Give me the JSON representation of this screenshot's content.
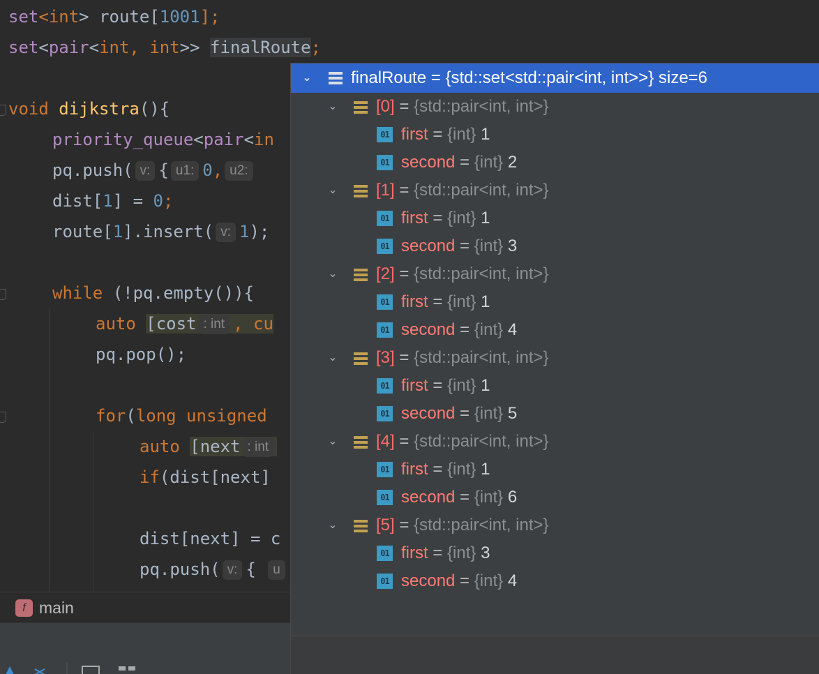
{
  "editor": {
    "line1": {
      "kw": "set",
      "targ1": "<",
      "targ_kw": "int",
      "targ2": "> route[",
      "num": "1001",
      "end": "];"
    },
    "line2": {
      "kw": "set",
      "a": "<",
      "b": "pair",
      "c": "<",
      "d": "int",
      "e": ", ",
      "f": "int",
      "g": ">> ",
      "name": "finalRoute",
      "end": ";"
    },
    "line3": {
      "kw": "void",
      "fn": "dijkstra",
      "rest": "(){"
    },
    "line4": {
      "type": "priority_queue",
      "lt": "<",
      "pair": "pair",
      "lt2": "<",
      "rest": "in"
    },
    "line5": {
      "obj": "pq.push(",
      "hint_v": "v:",
      "brace": "{",
      "hint_u1": "u1:",
      "num0": "0",
      "comma": ",",
      "hint_u2": "u2:"
    },
    "line6": {
      "text": "dist[",
      "num1": "1",
      "text2": "] = ",
      "num0": "0",
      "end": ";"
    },
    "line7": {
      "text": "route[",
      "num1": "1",
      "text2": "].insert(",
      "hint_v": "v:",
      "num": "1",
      "end": ");"
    },
    "line8": {
      "kw": "while",
      "rest": " (!pq.empty()){"
    },
    "line9": {
      "kw": "auto",
      "open": "[cost",
      "hint": ": int",
      "rest": ", cu"
    },
    "line10": {
      "text": "pq.pop();"
    },
    "line11": {
      "kw": "for",
      "open": "(",
      "kw2": "long unsigned"
    },
    "line12": {
      "kw": "auto",
      "open": "[next",
      "hint": ": int"
    },
    "line13": {
      "kw": "if",
      "rest": "(dist[next]"
    },
    "line14": {
      "text": "dist[next] = c"
    },
    "line15": {
      "text": "pq.push(",
      "hint_v": "v:",
      "brace": "{",
      "rest": "u"
    }
  },
  "breadcrumb": {
    "badge": "f",
    "label": "main"
  },
  "debug_popup": {
    "root": {
      "name": "finalRoute",
      "eq": " = ",
      "type": "{std::set<std::pair<int, int>>}",
      "size": " size=6"
    },
    "entries": [
      {
        "index": "[0]",
        "type": "{std::pair<int, int>}",
        "first": "1",
        "second": "2"
      },
      {
        "index": "[1]",
        "type": "{std::pair<int, int>}",
        "first": "1",
        "second": "3"
      },
      {
        "index": "[2]",
        "type": "{std::pair<int, int>}",
        "first": "1",
        "second": "4"
      },
      {
        "index": "[3]",
        "type": "{std::pair<int, int>}",
        "first": "1",
        "second": "5"
      },
      {
        "index": "[4]",
        "type": "{std::pair<int, int>}",
        "first": "1",
        "second": "6"
      },
      {
        "index": "[5]",
        "type": "{std::pair<int, int>}",
        "first": "3",
        "second": "4"
      }
    ],
    "labels": {
      "first": "first",
      "second": "second",
      "eq": " = ",
      "int_type": "{int}",
      "prim_icon": "01",
      "chevron": "⌄"
    }
  },
  "colors": {
    "selection": "#2f65ca",
    "keyword": "#cc7832",
    "function": "#ffc66d",
    "number": "#6897bb",
    "error_red": "#ff6b68"
  }
}
